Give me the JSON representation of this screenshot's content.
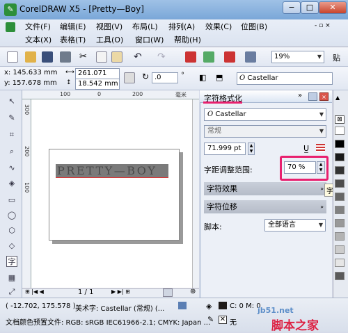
{
  "window": {
    "title": "CorelDRAW X5 - [Pretty—Boy]",
    "minimize": "−",
    "restore": "□",
    "close": "✕"
  },
  "menu": {
    "row1": [
      "文件(F)",
      "编辑(E)",
      "视图(V)",
      "布局(L)",
      "排列(A)",
      "效果(C)",
      "位图(B)"
    ],
    "row2": [
      "文本(X)",
      "表格(T)",
      "工具(O)",
      "窗口(W)",
      "帮助(H)"
    ]
  },
  "toolbar": {
    "zoom": "19%",
    "extra_label": "贴"
  },
  "propbar": {
    "x": "x: 145.633 mm",
    "y": "y: 157.678 mm",
    "width": "261.071 mm",
    "height": "18.542 mm",
    "rotation": ".0",
    "rotation_unit": "°",
    "font": "Castellar"
  },
  "ruler": {
    "h_ticks": [
      "100",
      "0",
      "200"
    ],
    "v_ticks": [
      "300",
      "200",
      "100"
    ],
    "unit": "毫米"
  },
  "canvas": {
    "text": "PRETTY—BOY"
  },
  "pagenav": {
    "page": "1 / 1"
  },
  "docker": {
    "title": "字符格式化",
    "font": "Castellar",
    "style": "常规",
    "size": "71.999 pt",
    "spacing_label": "字距调整范围:",
    "spacing_value": "70 %",
    "tooltip": "字距调",
    "sections": [
      "字符效果",
      "字符位移"
    ],
    "script_label": "脚本:",
    "script_value": "全部语言"
  },
  "palette": {
    "colors": [
      "#ffffff",
      "#000000",
      "#1a1a1a",
      "#333333",
      "#4d4d4d",
      "#666666",
      "#808080",
      "#999999",
      "#b3b3b3",
      "#cccccc",
      "#e6e6e6",
      "#5a5a5a"
    ]
  },
  "status": {
    "coords": "( -12.702, 175.578 )",
    "object": "美术字: Castellar (常规) (...",
    "profile": "文档颜色预置文件: RGB: sRGB IEC61966-2.1; CMYK: Japan ...",
    "fill": "C: 0 M: 0",
    "outline": "无"
  },
  "watermark": {
    "site": "jb51.net",
    "brand": "脚本之家"
  },
  "accent": "#e8206e"
}
